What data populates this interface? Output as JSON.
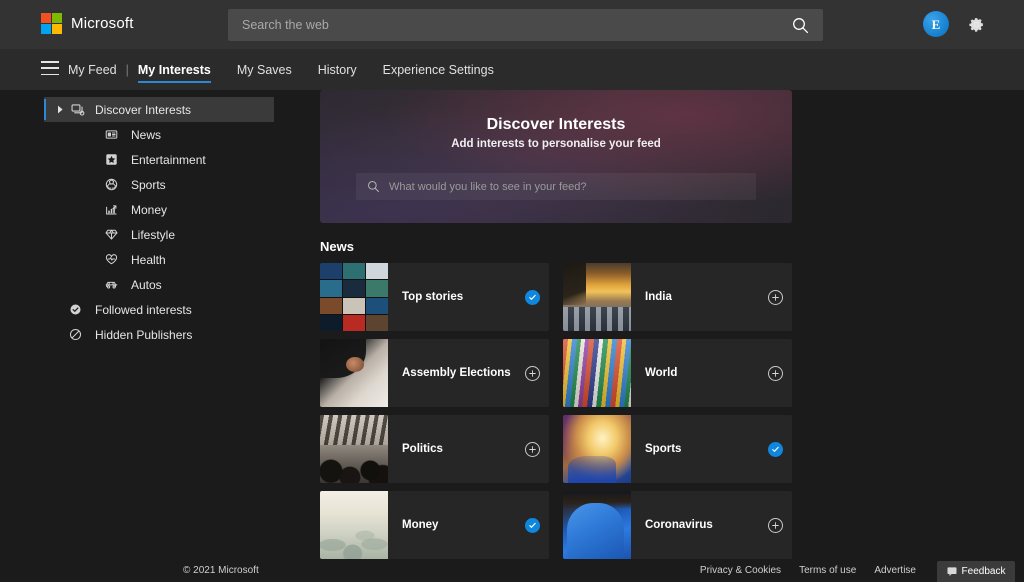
{
  "header": {
    "brand": "Microsoft",
    "search_placeholder": "Search the web",
    "search_value": "",
    "avatar_initial": "E",
    "logo_colors": [
      "#f25022",
      "#7fba00",
      "#00a4ef",
      "#ffb900"
    ]
  },
  "nav": {
    "separator": "|",
    "items": [
      {
        "label": "My Feed",
        "active": false
      },
      {
        "label": "My Interests",
        "active": true
      },
      {
        "label": "My Saves",
        "active": false
      },
      {
        "label": "History",
        "active": false
      },
      {
        "label": "Experience Settings",
        "active": false
      }
    ],
    "accent": "#2b88d8"
  },
  "sidebar": {
    "items": [
      {
        "label": "Discover Interests",
        "icon": "discover-icon",
        "level": 0,
        "active": true,
        "expandable": true
      },
      {
        "label": "News",
        "icon": "news-icon",
        "level": 1,
        "active": false
      },
      {
        "label": "Entertainment",
        "icon": "star-icon",
        "level": 1,
        "active": false
      },
      {
        "label": "Sports",
        "icon": "ball-icon",
        "level": 1,
        "active": false
      },
      {
        "label": "Money",
        "icon": "chart-icon",
        "level": 1,
        "active": false
      },
      {
        "label": "Lifestyle",
        "icon": "diamond-icon",
        "level": 1,
        "active": false
      },
      {
        "label": "Health",
        "icon": "heart-icon",
        "level": 1,
        "active": false
      },
      {
        "label": "Autos",
        "icon": "car-icon",
        "level": 1,
        "active": false
      },
      {
        "label": "Followed interests",
        "icon": "check-circle-icon",
        "level": 2,
        "active": false
      },
      {
        "label": "Hidden Publishers",
        "icon": "block-icon",
        "level": 2,
        "active": false
      }
    ]
  },
  "hero": {
    "title": "Discover Interests",
    "subtitle": "Add interests to personalise your feed",
    "search_placeholder": "What would you like to see in your feed?",
    "search_value": ""
  },
  "main": {
    "section_title": "News",
    "cards": [
      {
        "label": "Top stories",
        "thumb": "t-topstories",
        "selected": true
      },
      {
        "label": "India",
        "thumb": "t-india",
        "selected": false
      },
      {
        "label": "Assembly Elections",
        "thumb": "t-assembly",
        "selected": false
      },
      {
        "label": "World",
        "thumb": "t-world",
        "selected": false
      },
      {
        "label": "Politics",
        "thumb": "t-politics",
        "selected": false
      },
      {
        "label": "Sports",
        "thumb": "t-sports",
        "selected": true
      },
      {
        "label": "Money",
        "thumb": "t-money",
        "selected": true
      },
      {
        "label": "Coronavirus",
        "thumb": "t-corona",
        "selected": false
      }
    ],
    "selected_color": "#0f87de"
  },
  "footer": {
    "copyright": "© 2021 Microsoft",
    "links": [
      "Privacy & Cookies",
      "Terms of use",
      "Advertise"
    ],
    "feedback_label": "Feedback"
  }
}
